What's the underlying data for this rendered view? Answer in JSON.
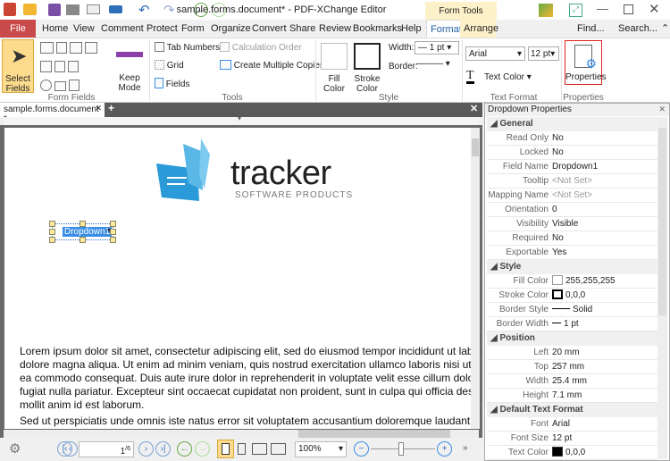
{
  "window": {
    "title": "sample.forms.document* - PDF-XChange Editor",
    "context_tab": "Form Tools"
  },
  "menu": {
    "items": [
      "File",
      "Home",
      "View",
      "Comment",
      "Protect",
      "Form",
      "Organize",
      "Convert",
      "Share",
      "Review",
      "Bookmarks",
      "Help",
      "Format",
      "Arrange"
    ],
    "active": "Format",
    "find": "Find...",
    "search": "Search..."
  },
  "ribbon": {
    "select_fields": "Select Fields",
    "keep_mode": "Keep Mode",
    "form_fields_group": "Form Fields",
    "tab_numbers": "Tab Numbers",
    "calculation_order": "Calculation Order",
    "grid": "Grid",
    "create_multiple_copies": "Create Multiple Copies",
    "fields": "Fields",
    "tools_group": "Tools",
    "fill_color": "Fill Color",
    "stroke_color": "Stroke Color",
    "width_label": "Width:",
    "width_value": "1 pt",
    "border_label": "Border:",
    "style_group": "Style",
    "font": "Arial",
    "font_size": "12 pt",
    "text_color": "Text Color",
    "text_format_group": "Text Format",
    "properties": "Properties",
    "properties_group": "Properties"
  },
  "document": {
    "tab": "sample.forms.document *",
    "logo_word": "tracker",
    "logo_sub": "SOFTWARE PRODUCTS",
    "field_name": "Dropdown1",
    "body_lines": [
      "Lorem ipsum dolor sit amet, consectetur adipiscing elit, sed do eiusmod tempor incididunt ut labor",
      "dolore magna aliqua. Ut enim ad minim veniam, quis nostrud exercitation ullamco laboris nisi ut aliqui",
      "ea commodo consequat. Duis aute irure dolor in reprehenderit in voluptate velit esse cillum dolore",
      "fugiat nulla pariatur. Excepteur sint occaecat cupidatat non proident, sunt in culpa qui officia dese",
      "mollit anim id est laborum."
    ],
    "body_line2": "Sed ut perspiciatis unde omnis iste natus error sit voluptatem accusantium doloremque laudantium, to"
  },
  "panel": {
    "title": "Dropdown Properties",
    "general": "General",
    "style": "Style",
    "position": "Position",
    "default_text_format": "Default Text Format",
    "general_rows": [
      [
        "Read Only",
        "No"
      ],
      [
        "Locked",
        "No"
      ],
      [
        "Field Name",
        "Dropdown1"
      ],
      [
        "Tooltip",
        "<Not Set>"
      ],
      [
        "Mapping Name",
        "<Not Set>"
      ],
      [
        "Orientation",
        "0"
      ],
      [
        "Visibility",
        "Visible"
      ],
      [
        "Required",
        "No"
      ],
      [
        "Exportable",
        "Yes"
      ]
    ],
    "style_rows": [
      [
        "Fill Color",
        "255,255,255"
      ],
      [
        "Stroke Color",
        "0,0,0"
      ],
      [
        "Border Style",
        "Solid"
      ],
      [
        "Border Width",
        "1 pt"
      ]
    ],
    "position_rows": [
      [
        "Left",
        "20 mm"
      ],
      [
        "Top",
        "257 mm"
      ],
      [
        "Width",
        "25.4 mm"
      ],
      [
        "Height",
        "7.1 mm"
      ]
    ],
    "text_rows": [
      [
        "Font",
        "Arial"
      ],
      [
        "Font Size",
        "12 pt"
      ],
      [
        "Text Color",
        "0,0,0"
      ]
    ],
    "fill_swatch": "#ffffff",
    "stroke_swatch": "#000000",
    "text_swatch": "#000000"
  },
  "statusbar": {
    "page": "1",
    "page_total": "/6",
    "zoom": "100%"
  },
  "colors": {
    "file_tab": "#c94a4a",
    "accent": "#1f5fa8",
    "context": "#fdf1c9",
    "selection": "#3a8ee6",
    "logo_blue": "#2a9ad8"
  }
}
